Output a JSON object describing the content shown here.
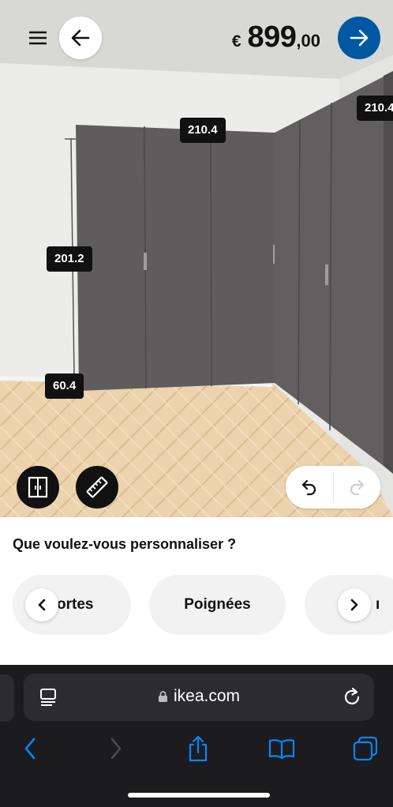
{
  "header": {
    "price_currency": "€",
    "price_integer": "899",
    "price_decimal": ",00"
  },
  "dimensions": {
    "top_width": "210.4",
    "right_width": "210.4",
    "height": "201.2",
    "depth": "60.4"
  },
  "customize": {
    "title": "Que voulez-vous personnaliser ?",
    "chips": [
      "ortes",
      "Poignées",
      "ı"
    ]
  },
  "browser": {
    "url": "ikea.com"
  },
  "colors": {
    "accent": "#0058a3",
    "wardrobe": "#5f5c5e",
    "floor": "#e8cfa8"
  },
  "icons": {
    "menu": "hamburger-icon",
    "back": "arrow-left-icon",
    "next": "arrow-right-icon",
    "door_view": "door-icon",
    "measure": "ruler-icon",
    "undo": "undo-icon",
    "redo": "redo-icon"
  }
}
